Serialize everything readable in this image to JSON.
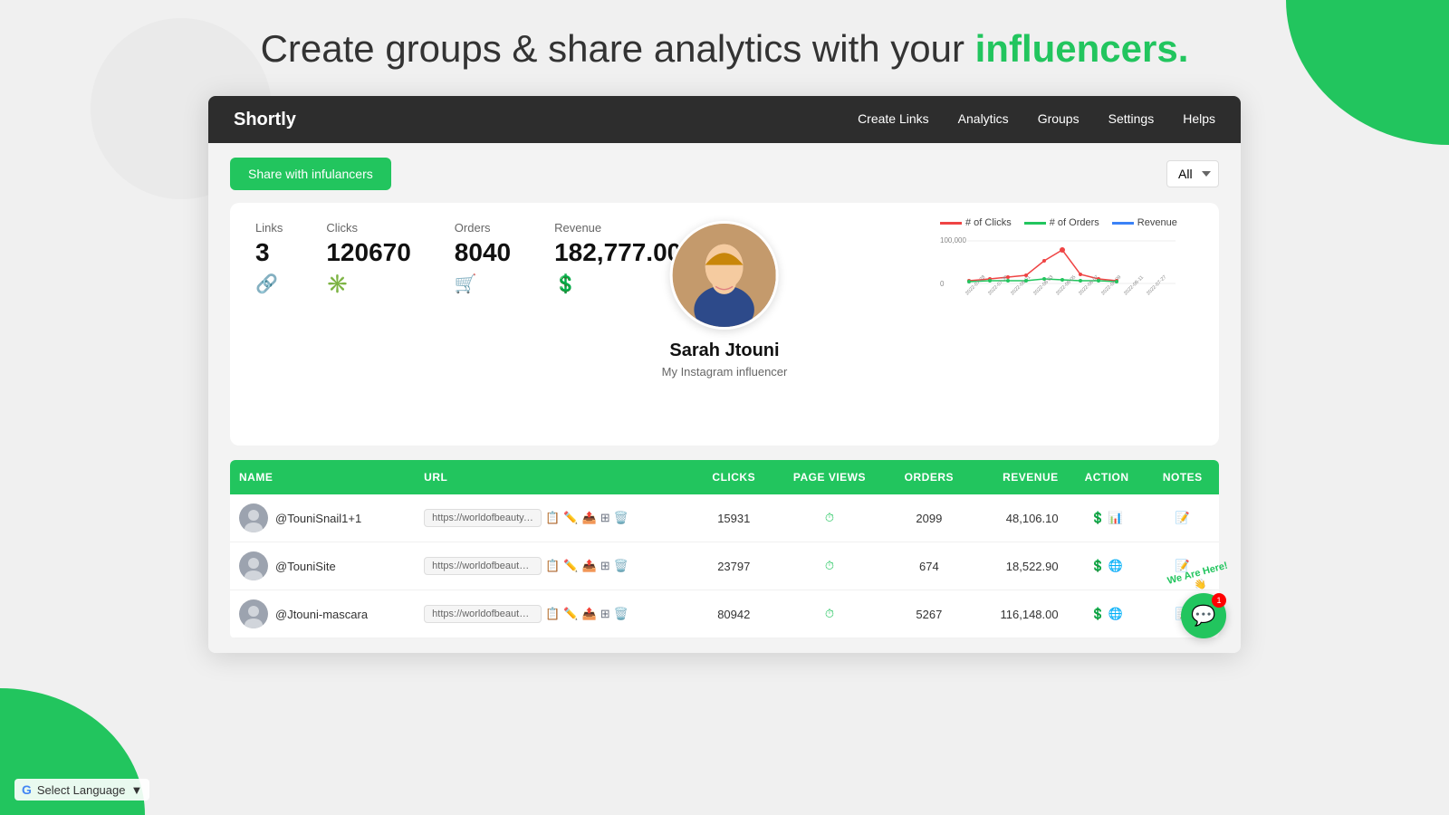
{
  "hero": {
    "title_part1": "Create groups & share analytics with your ",
    "title_highlight": "influencers.",
    "title_bg_shape": ""
  },
  "navbar": {
    "brand": "Shortly",
    "links": [
      {
        "label": "Create Links",
        "id": "create-links"
      },
      {
        "label": "Analytics",
        "id": "analytics"
      },
      {
        "label": "Groups",
        "id": "groups"
      },
      {
        "label": "Settings",
        "id": "settings"
      },
      {
        "label": "Helps",
        "id": "helps"
      }
    ]
  },
  "topbar": {
    "share_btn": "Share with infulancers",
    "filter_label": "All"
  },
  "stats": {
    "links_label": "Links",
    "links_value": "3",
    "clicks_label": "Clicks",
    "clicks_value": "120670",
    "orders_label": "Orders",
    "orders_value": "8040",
    "revenue_label": "Revenue",
    "revenue_value": "182,777.00"
  },
  "profile": {
    "name": "Sarah Jtouni",
    "description": "My Instagram influencer",
    "avatar_emoji": "👩"
  },
  "chart": {
    "legend": [
      {
        "label": "# of Clicks",
        "color": "#ef4444"
      },
      {
        "label": "# of Orders",
        "color": "#22c55e"
      },
      {
        "label": "Revenue",
        "color": "#3b82f6"
      }
    ],
    "y_max": "100,000",
    "y_min": "0",
    "dates": [
      "2022-07-28",
      "2022-07-30",
      "2022-08-01",
      "2022-08-03",
      "2022-08-05",
      "2022-08-07",
      "2022-08-09",
      "2022-08-11",
      "2022-07-27"
    ]
  },
  "table": {
    "headers": [
      {
        "label": "NAME",
        "key": "name"
      },
      {
        "label": "URL",
        "key": "url"
      },
      {
        "label": "CLICKS",
        "key": "clicks"
      },
      {
        "label": "PAGE VIEWS",
        "key": "page_views"
      },
      {
        "label": "ORDERS",
        "key": "orders"
      },
      {
        "label": "REVENUE",
        "key": "revenue"
      },
      {
        "label": "ACTION",
        "key": "action"
      },
      {
        "label": "NOTES",
        "key": "notes"
      }
    ],
    "rows": [
      {
        "name": "@TouniSnail1+1",
        "url": "https://worldofbeauty.g...",
        "clicks": "15931",
        "page_views_icon": "clock",
        "orders": "2099",
        "revenue": "48,106.10",
        "avatar_emoji": "👤"
      },
      {
        "name": "@TouniSite",
        "url": "https://worldofbeautys...",
        "clicks": "23797",
        "page_views_icon": "clock",
        "orders": "674",
        "revenue": "18,522.90",
        "avatar_emoji": "👤"
      },
      {
        "name": "@Jtouni-mascara",
        "url": "https://worldofbeautyme...",
        "clicks": "80942",
        "page_views_icon": "clock",
        "orders": "5267",
        "revenue": "116,148.00",
        "avatar_emoji": "👤"
      }
    ]
  },
  "chat": {
    "badge": "1",
    "we_are_here_line1": "We Are Here",
    "emoji": "💬"
  },
  "language": {
    "label": "Select Language",
    "google_logo": "G"
  }
}
